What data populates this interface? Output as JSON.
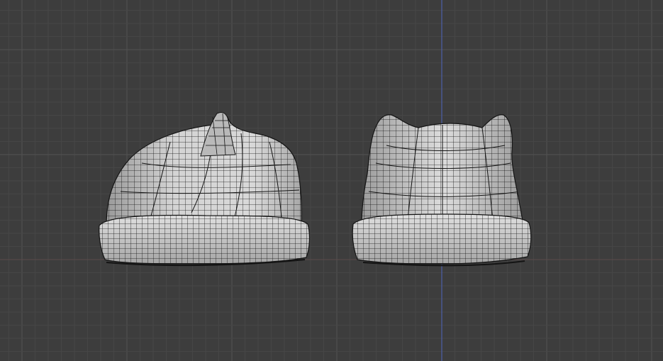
{
  "viewport": {
    "view": "3d-viewport-wireframe",
    "colors": {
      "background": "#3d3d3d",
      "grid_minor": "#464646",
      "grid_major": "#525252",
      "axis_vertical": "#4d5fa8",
      "axis_horizontal": "#5a4a4a",
      "mesh_fill": "#c9c9c9",
      "mesh_shade": "#8c8c8c",
      "wire": "#141414"
    }
  },
  "objects": [
    {
      "name": "beanie-side-view",
      "kind": "hat-mesh",
      "ears": 1
    },
    {
      "name": "beanie-front-view",
      "kind": "hat-mesh",
      "ears": 2
    }
  ]
}
